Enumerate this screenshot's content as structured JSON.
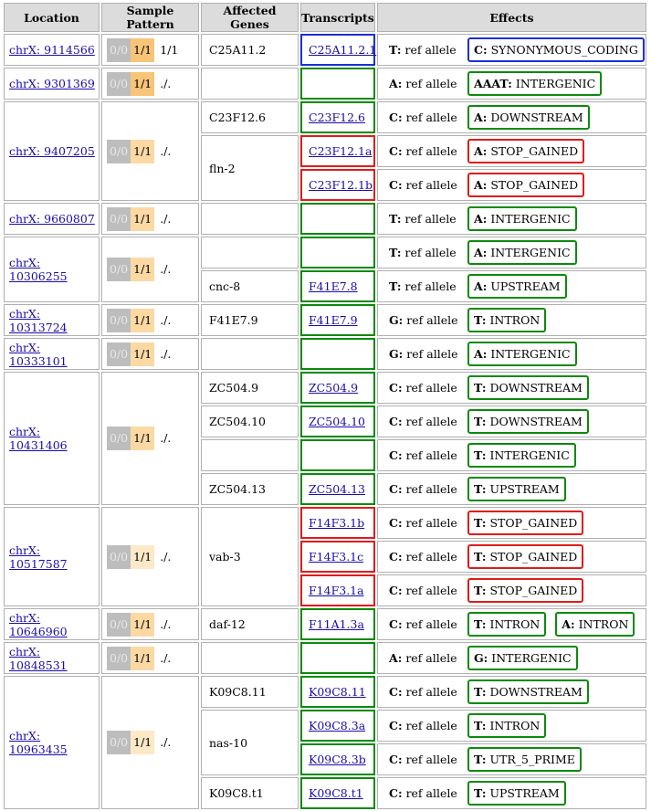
{
  "colors": {
    "high": "#e01b1b",
    "moderate": "#0b8a0b",
    "low": "#1a2fd6",
    "ref_genotype": "#bdbdbd",
    "alt_genotype": "#fcd9a3"
  },
  "headers": [
    "Location",
    "Sample Pattern",
    "Affected Genes",
    "Transcripts",
    "Effects"
  ],
  "ref_allele_label": "ref allele",
  "variants": [
    {
      "location": "chrX: 9114566",
      "gt_ref": "0/0",
      "gt_alt": "1/1",
      "pattern": "1/1",
      "alt_strong": true,
      "genes": [
        {
          "name": "C25A11.2",
          "transcripts": [
            {
              "id": "C25A11.2.1",
              "impact": "low",
              "ref": "T:",
              "effects": [
                {
                  "allele": "C:",
                  "effect": "SYNONYMOUS_CODING",
                  "impact": "low"
                }
              ]
            }
          ]
        }
      ]
    },
    {
      "location": "chrX: 9301369",
      "gt_ref": "0/0",
      "gt_alt": "1/1",
      "pattern": "./.",
      "alt_strong": true,
      "genes": [
        {
          "name": "",
          "transcripts": [
            {
              "id": "",
              "impact": "mod",
              "ref": "A:",
              "effects": [
                {
                  "allele": "AAAT:",
                  "effect": "INTERGENIC",
                  "impact": "mod"
                }
              ]
            }
          ]
        }
      ]
    },
    {
      "location": "chrX: 9407205",
      "gt_ref": "0/0",
      "gt_alt": "1/1",
      "pattern": "./.",
      "alt_strong": false,
      "genes": [
        {
          "name": "C23F12.6",
          "transcripts": [
            {
              "id": "C23F12.6",
              "impact": "mod",
              "ref": "C:",
              "effects": [
                {
                  "allele": "A:",
                  "effect": "DOWNSTREAM",
                  "impact": "mod"
                }
              ]
            }
          ]
        },
        {
          "name": "fln-2",
          "transcripts": [
            {
              "id": "C23F12.1a",
              "impact": "high",
              "ref": "C:",
              "effects": [
                {
                  "allele": "A:",
                  "effect": "STOP_GAINED",
                  "impact": "high"
                }
              ]
            },
            {
              "id": "C23F12.1b",
              "impact": "high",
              "ref": "C:",
              "effects": [
                {
                  "allele": "A:",
                  "effect": "STOP_GAINED",
                  "impact": "high"
                }
              ]
            }
          ]
        }
      ]
    },
    {
      "location": "chrX: 9660807",
      "gt_ref": "0/0",
      "gt_alt": "1/1",
      "pattern": "./.",
      "alt_strong": false,
      "genes": [
        {
          "name": "",
          "transcripts": [
            {
              "id": "",
              "impact": "mod",
              "ref": "T:",
              "effects": [
                {
                  "allele": "A:",
                  "effect": "INTERGENIC",
                  "impact": "mod"
                }
              ]
            }
          ]
        }
      ]
    },
    {
      "location": "chrX: 10306255",
      "gt_ref": "0/0",
      "gt_alt": "1/1",
      "pattern": "./.",
      "alt_strong": false,
      "genes": [
        {
          "name": "",
          "transcripts": [
            {
              "id": "",
              "impact": "mod",
              "ref": "T:",
              "effects": [
                {
                  "allele": "A:",
                  "effect": "INTERGENIC",
                  "impact": "mod"
                }
              ]
            }
          ]
        },
        {
          "name": "cnc-8",
          "transcripts": [
            {
              "id": "F41E7.8",
              "impact": "mod",
              "ref": "T:",
              "effects": [
                {
                  "allele": "A:",
                  "effect": "UPSTREAM",
                  "impact": "mod"
                }
              ]
            }
          ]
        }
      ]
    },
    {
      "location": "chrX: 10313724",
      "gt_ref": "0/0",
      "gt_alt": "1/1",
      "pattern": "./.",
      "alt_strong": false,
      "genes": [
        {
          "name": "F41E7.9",
          "transcripts": [
            {
              "id": "F41E7.9",
              "impact": "mod",
              "ref": "G:",
              "effects": [
                {
                  "allele": "T:",
                  "effect": "INTRON",
                  "impact": "mod"
                }
              ]
            }
          ]
        }
      ]
    },
    {
      "location": "chrX: 10333101",
      "gt_ref": "0/0",
      "gt_alt": "1/1",
      "pattern": "./.",
      "alt_strong": false,
      "genes": [
        {
          "name": "",
          "transcripts": [
            {
              "id": "",
              "impact": "mod",
              "ref": "G:",
              "effects": [
                {
                  "allele": "A:",
                  "effect": "INTERGENIC",
                  "impact": "mod"
                }
              ]
            }
          ]
        }
      ]
    },
    {
      "location": "chrX: 10431406",
      "gt_ref": "0/0",
      "gt_alt": "1/1",
      "pattern": "./.",
      "alt_strong": false,
      "genes": [
        {
          "name": "ZC504.9",
          "transcripts": [
            {
              "id": "ZC504.9",
              "impact": "mod",
              "ref": "C:",
              "effects": [
                {
                  "allele": "T:",
                  "effect": "DOWNSTREAM",
                  "impact": "mod"
                }
              ]
            }
          ]
        },
        {
          "name": "ZC504.10",
          "transcripts": [
            {
              "id": "ZC504.10",
              "impact": "mod",
              "ref": "C:",
              "effects": [
                {
                  "allele": "T:",
                  "effect": "DOWNSTREAM",
                  "impact": "mod"
                }
              ]
            }
          ]
        },
        {
          "name": "",
          "transcripts": [
            {
              "id": "",
              "impact": "mod",
              "ref": "C:",
              "effects": [
                {
                  "allele": "T:",
                  "effect": "INTERGENIC",
                  "impact": "mod"
                }
              ]
            }
          ]
        },
        {
          "name": "ZC504.13",
          "transcripts": [
            {
              "id": "ZC504.13",
              "impact": "mod",
              "ref": "C:",
              "effects": [
                {
                  "allele": "T:",
                  "effect": "UPSTREAM",
                  "impact": "mod"
                }
              ]
            }
          ]
        }
      ]
    },
    {
      "location": "chrX: 10517587",
      "gt_ref": "0/0",
      "gt_alt": "1/1",
      "pattern": "./.",
      "alt_strong": false,
      "alt_faint": true,
      "genes": [
        {
          "name": "vab-3",
          "transcripts": [
            {
              "id": "F14F3.1b",
              "impact": "high",
              "ref": "C:",
              "effects": [
                {
                  "allele": "T:",
                  "effect": "STOP_GAINED",
                  "impact": "high"
                }
              ]
            },
            {
              "id": "F14F3.1c",
              "impact": "high",
              "ref": "C:",
              "effects": [
                {
                  "allele": "T:",
                  "effect": "STOP_GAINED",
                  "impact": "high"
                }
              ]
            },
            {
              "id": "F14F3.1a",
              "impact": "high",
              "ref": "C:",
              "effects": [
                {
                  "allele": "T:",
                  "effect": "STOP_GAINED",
                  "impact": "high"
                }
              ]
            }
          ]
        }
      ]
    },
    {
      "location": "chrX: 10646960",
      "gt_ref": "0/0",
      "gt_alt": "1/1",
      "pattern": "./.",
      "alt_strong": false,
      "genes": [
        {
          "name": "daf-12",
          "transcripts": [
            {
              "id": "F11A1.3a",
              "impact": "mod",
              "ref": "C:",
              "effects": [
                {
                  "allele": "T:",
                  "effect": "INTRON",
                  "impact": "mod"
                },
                {
                  "allele": "A:",
                  "effect": "INTRON",
                  "impact": "mod"
                }
              ]
            }
          ]
        }
      ]
    },
    {
      "location": "chrX: 10848531",
      "gt_ref": "0/0",
      "gt_alt": "1/1",
      "pattern": "./.",
      "alt_strong": false,
      "genes": [
        {
          "name": "",
          "transcripts": [
            {
              "id": "",
              "impact": "mod",
              "ref": "A:",
              "effects": [
                {
                  "allele": "G:",
                  "effect": "INTERGENIC",
                  "impact": "mod"
                }
              ]
            }
          ]
        }
      ]
    },
    {
      "location": "chrX: 10963435",
      "gt_ref": "0/0",
      "gt_alt": "1/1",
      "pattern": "./.",
      "alt_strong": false,
      "alt_faint": true,
      "genes": [
        {
          "name": "K09C8.11",
          "transcripts": [
            {
              "id": "K09C8.11",
              "impact": "mod",
              "ref": "C:",
              "effects": [
                {
                  "allele": "T:",
                  "effect": "DOWNSTREAM",
                  "impact": "mod"
                }
              ]
            }
          ]
        },
        {
          "name": "nas-10",
          "transcripts": [
            {
              "id": "K09C8.3a",
              "impact": "mod",
              "ref": "C:",
              "effects": [
                {
                  "allele": "T:",
                  "effect": "INTRON",
                  "impact": "mod"
                }
              ]
            },
            {
              "id": "K09C8.3b",
              "impact": "mod",
              "ref": "C:",
              "effects": [
                {
                  "allele": "T:",
                  "effect": "UTR_5_PRIME",
                  "impact": "mod"
                }
              ]
            }
          ]
        },
        {
          "name": "K09C8.t1",
          "transcripts": [
            {
              "id": "K09C8.t1",
              "impact": "mod",
              "ref": "C:",
              "effects": [
                {
                  "allele": "T:",
                  "effect": "UPSTREAM",
                  "impact": "mod"
                }
              ]
            }
          ]
        }
      ]
    }
  ]
}
